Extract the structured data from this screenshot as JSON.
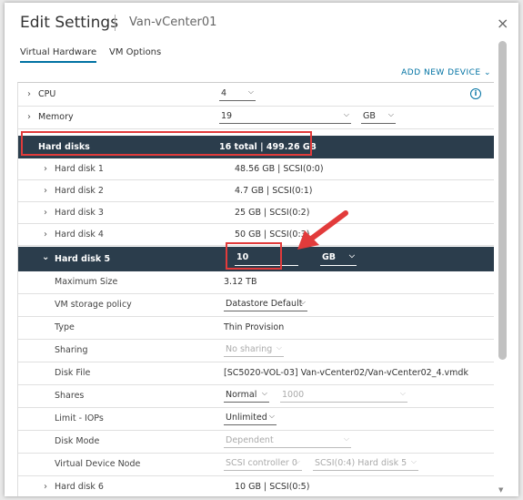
{
  "dialog": {
    "title": "Edit Settings",
    "subtitle": "Van-vCenter01",
    "close_icon": "×",
    "tabs": [
      {
        "label": "Virtual Hardware",
        "active": true
      },
      {
        "label": "VM Options",
        "active": false
      }
    ],
    "add_device_label": "ADD NEW DEVICE"
  },
  "hardware": {
    "cpu": {
      "label": "CPU",
      "value": "4"
    },
    "memory": {
      "label": "Memory",
      "value": "19",
      "unit": "GB"
    },
    "hard_disks": {
      "label": "Hard disks",
      "summary": "16 total | 499.26 GB"
    },
    "disks": [
      {
        "label": "Hard disk 1",
        "value": "48.56 GB | SCSI(0:0)"
      },
      {
        "label": "Hard disk 2",
        "value": "4.7 GB | SCSI(0:1)"
      },
      {
        "label": "Hard disk 3",
        "value": "25 GB | SCSI(0:2)"
      },
      {
        "label": "Hard disk 4",
        "value": "50 GB | SCSI(0:3)"
      }
    ],
    "disk5": {
      "label": "Hard disk 5",
      "size_value": "10",
      "unit": "GB",
      "details": {
        "max_size": {
          "label": "Maximum Size",
          "value": "3.12 TB"
        },
        "storage_policy": {
          "label": "VM storage policy",
          "value": "Datastore Default"
        },
        "type": {
          "label": "Type",
          "value": "Thin Provision"
        },
        "sharing": {
          "label": "Sharing",
          "value": "No sharing"
        },
        "disk_file": {
          "label": "Disk File",
          "value": "[SC5020-VOL-03] Van-vCenter02/Van-vCenter02_4.vmdk"
        },
        "shares": {
          "label": "Shares",
          "value": "Normal",
          "amount": "1000"
        },
        "limit_iops": {
          "label": "Limit - IOPs",
          "value": "Unlimited"
        },
        "disk_mode": {
          "label": "Disk Mode",
          "value": "Dependent"
        },
        "vdn": {
          "label": "Virtual Device Node",
          "controller": "SCSI controller 0",
          "node": "SCSI(0:4) Hard disk 5"
        }
      }
    },
    "disk6": {
      "label": "Hard disk 6",
      "value": "10 GB | SCSI(0:5)"
    }
  },
  "colors": {
    "accent": "#0072a3",
    "header_dark": "#2b3d4c",
    "highlight": "#e23b3b"
  },
  "icons": {
    "expand": "chevron-right-icon",
    "collapse": "chevron-down-icon",
    "info": "info-icon",
    "close": "close-icon"
  }
}
